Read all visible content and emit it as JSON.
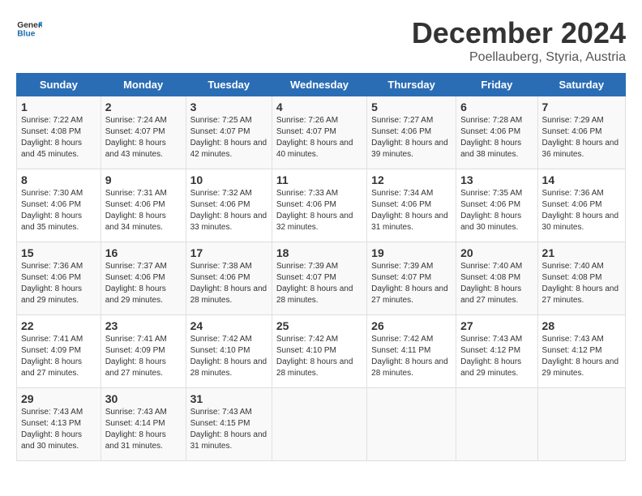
{
  "logo": {
    "text_general": "General",
    "text_blue": "Blue"
  },
  "title": "December 2024",
  "subtitle": "Poellauberg, Styria, Austria",
  "headers": [
    "Sunday",
    "Monday",
    "Tuesday",
    "Wednesday",
    "Thursday",
    "Friday",
    "Saturday"
  ],
  "weeks": [
    [
      {
        "day": "1",
        "sunrise": "7:22 AM",
        "sunset": "4:08 PM",
        "daylight": "8 hours and 45 minutes."
      },
      {
        "day": "2",
        "sunrise": "7:24 AM",
        "sunset": "4:07 PM",
        "daylight": "8 hours and 43 minutes."
      },
      {
        "day": "3",
        "sunrise": "7:25 AM",
        "sunset": "4:07 PM",
        "daylight": "8 hours and 42 minutes."
      },
      {
        "day": "4",
        "sunrise": "7:26 AM",
        "sunset": "4:07 PM",
        "daylight": "8 hours and 40 minutes."
      },
      {
        "day": "5",
        "sunrise": "7:27 AM",
        "sunset": "4:06 PM",
        "daylight": "8 hours and 39 minutes."
      },
      {
        "day": "6",
        "sunrise": "7:28 AM",
        "sunset": "4:06 PM",
        "daylight": "8 hours and 38 minutes."
      },
      {
        "day": "7",
        "sunrise": "7:29 AM",
        "sunset": "4:06 PM",
        "daylight": "8 hours and 36 minutes."
      }
    ],
    [
      {
        "day": "8",
        "sunrise": "7:30 AM",
        "sunset": "4:06 PM",
        "daylight": "8 hours and 35 minutes."
      },
      {
        "day": "9",
        "sunrise": "7:31 AM",
        "sunset": "4:06 PM",
        "daylight": "8 hours and 34 minutes."
      },
      {
        "day": "10",
        "sunrise": "7:32 AM",
        "sunset": "4:06 PM",
        "daylight": "8 hours and 33 minutes."
      },
      {
        "day": "11",
        "sunrise": "7:33 AM",
        "sunset": "4:06 PM",
        "daylight": "8 hours and 32 minutes."
      },
      {
        "day": "12",
        "sunrise": "7:34 AM",
        "sunset": "4:06 PM",
        "daylight": "8 hours and 31 minutes."
      },
      {
        "day": "13",
        "sunrise": "7:35 AM",
        "sunset": "4:06 PM",
        "daylight": "8 hours and 30 minutes."
      },
      {
        "day": "14",
        "sunrise": "7:36 AM",
        "sunset": "4:06 PM",
        "daylight": "8 hours and 30 minutes."
      }
    ],
    [
      {
        "day": "15",
        "sunrise": "7:36 AM",
        "sunset": "4:06 PM",
        "daylight": "8 hours and 29 minutes."
      },
      {
        "day": "16",
        "sunrise": "7:37 AM",
        "sunset": "4:06 PM",
        "daylight": "8 hours and 29 minutes."
      },
      {
        "day": "17",
        "sunrise": "7:38 AM",
        "sunset": "4:06 PM",
        "daylight": "8 hours and 28 minutes."
      },
      {
        "day": "18",
        "sunrise": "7:39 AM",
        "sunset": "4:07 PM",
        "daylight": "8 hours and 28 minutes."
      },
      {
        "day": "19",
        "sunrise": "7:39 AM",
        "sunset": "4:07 PM",
        "daylight": "8 hours and 27 minutes."
      },
      {
        "day": "20",
        "sunrise": "7:40 AM",
        "sunset": "4:08 PM",
        "daylight": "8 hours and 27 minutes."
      },
      {
        "day": "21",
        "sunrise": "7:40 AM",
        "sunset": "4:08 PM",
        "daylight": "8 hours and 27 minutes."
      }
    ],
    [
      {
        "day": "22",
        "sunrise": "7:41 AM",
        "sunset": "4:09 PM",
        "daylight": "8 hours and 27 minutes."
      },
      {
        "day": "23",
        "sunrise": "7:41 AM",
        "sunset": "4:09 PM",
        "daylight": "8 hours and 27 minutes."
      },
      {
        "day": "24",
        "sunrise": "7:42 AM",
        "sunset": "4:10 PM",
        "daylight": "8 hours and 28 minutes."
      },
      {
        "day": "25",
        "sunrise": "7:42 AM",
        "sunset": "4:10 PM",
        "daylight": "8 hours and 28 minutes."
      },
      {
        "day": "26",
        "sunrise": "7:42 AM",
        "sunset": "4:11 PM",
        "daylight": "8 hours and 28 minutes."
      },
      {
        "day": "27",
        "sunrise": "7:43 AM",
        "sunset": "4:12 PM",
        "daylight": "8 hours and 29 minutes."
      },
      {
        "day": "28",
        "sunrise": "7:43 AM",
        "sunset": "4:12 PM",
        "daylight": "8 hours and 29 minutes."
      }
    ],
    [
      {
        "day": "29",
        "sunrise": "7:43 AM",
        "sunset": "4:13 PM",
        "daylight": "8 hours and 30 minutes."
      },
      {
        "day": "30",
        "sunrise": "7:43 AM",
        "sunset": "4:14 PM",
        "daylight": "8 hours and 31 minutes."
      },
      {
        "day": "31",
        "sunrise": "7:43 AM",
        "sunset": "4:15 PM",
        "daylight": "8 hours and 31 minutes."
      },
      null,
      null,
      null,
      null
    ]
  ],
  "labels": {
    "sunrise": "Sunrise:",
    "sunset": "Sunset:",
    "daylight": "Daylight:"
  }
}
